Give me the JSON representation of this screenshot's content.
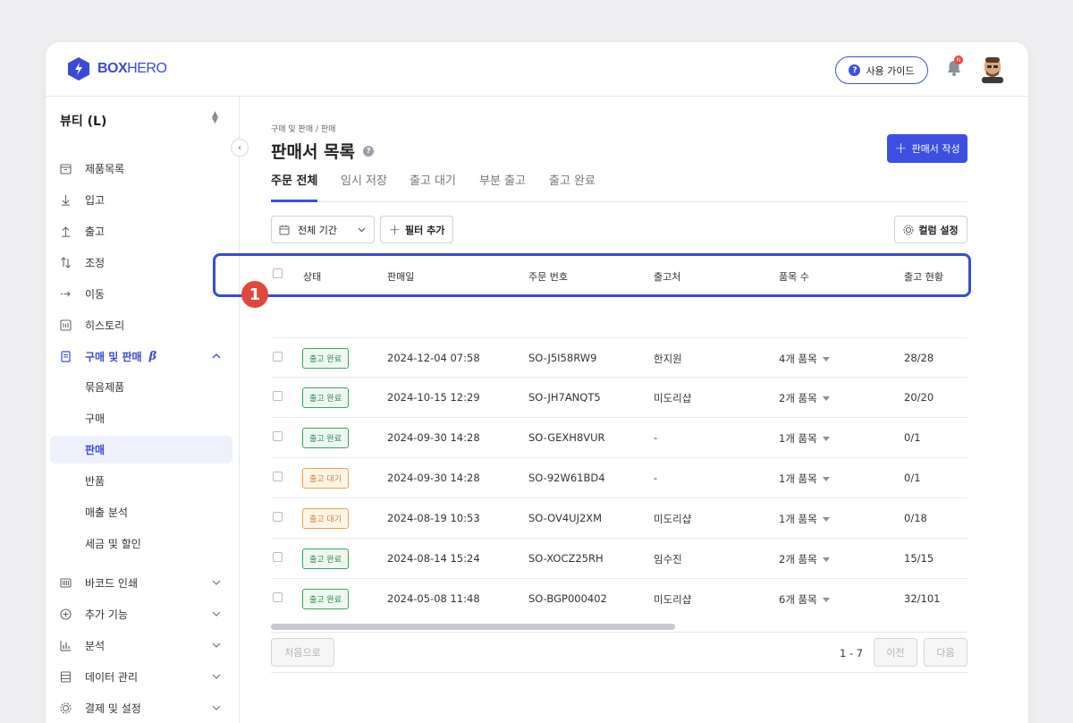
{
  "brand": {
    "name_bold": "BOX",
    "name_light": "HERO",
    "color": "#3a4ad6"
  },
  "header": {
    "guide_label": "사용 가이드",
    "notification_badge": "N"
  },
  "sidebar": {
    "company": "뷰티 (L)",
    "items": [
      {
        "label": "제품목록",
        "icon": "box-icon"
      },
      {
        "label": "입고",
        "icon": "arrow-down-icon"
      },
      {
        "label": "출고",
        "icon": "arrow-up-icon"
      },
      {
        "label": "조정",
        "icon": "swap-icon"
      },
      {
        "label": "이동",
        "icon": "arrow-right-icon"
      },
      {
        "label": "히스토리",
        "icon": "history-icon"
      },
      {
        "label": "구매 및 판매",
        "icon": "document-icon",
        "beta": "β"
      }
    ],
    "sub_items": [
      "묶음제품",
      "구매",
      "판매",
      "반품",
      "매출 분석",
      "세금 및 할인"
    ],
    "bottom_items": [
      {
        "label": "바코드 인쇄",
        "icon": "barcode-icon"
      },
      {
        "label": "추가 기능",
        "icon": "plus-circle-icon"
      },
      {
        "label": "분석",
        "icon": "bar-chart-icon"
      },
      {
        "label": "데이터 관리",
        "icon": "database-icon"
      },
      {
        "label": "결제 및 설정",
        "icon": "gear-icon"
      }
    ]
  },
  "main": {
    "breadcrumb": "구매 및 판매 / 판매",
    "title": "판매서 목록",
    "create_label": "판매서 작성",
    "tabs": [
      "주문 전체",
      "임시 저장",
      "출고 대기",
      "부분 출고",
      "출고 완료"
    ],
    "filters": {
      "period": "전체 기간",
      "add_filter": "필터 추가",
      "column_settings": "컬럼 설정"
    },
    "columns": [
      "상태",
      "판매일",
      "주문 번호",
      "출고처",
      "품목 수",
      "출고 현황"
    ],
    "rows": [
      {
        "status": "출고 완료",
        "date": "2024-12-04 07:58",
        "order": "SO-J5I58RW9",
        "dest": "한지원",
        "items": "4개 품목",
        "progress": "28/28"
      },
      {
        "status": "출고 완료",
        "date": "2024-10-15 12:29",
        "order": "SO-JH7ANQT5",
        "dest": "미도리샵",
        "items": "2개 품목",
        "progress": "20/20"
      },
      {
        "status": "출고 완료",
        "date": "2024-09-30 14:28",
        "order": "SO-GEXH8VUR",
        "dest": "-",
        "items": "1개 품목",
        "progress": "0/1"
      },
      {
        "status": "출고 대기",
        "date": "2024-09-30 14:28",
        "order": "SO-92W61BD4",
        "dest": "-",
        "items": "1개 품목",
        "progress": "0/1"
      },
      {
        "status": "출고 대기",
        "date": "2024-08-19 10:53",
        "order": "SO-OV4UJ2XM",
        "dest": "미도리샵",
        "items": "1개 품목",
        "progress": "0/18"
      },
      {
        "status": "출고 완료",
        "date": "2024-08-14 15:24",
        "order": "SO-XOCZ25RH",
        "dest": "임수진",
        "items": "2개 품목",
        "progress": "15/15"
      },
      {
        "status": "출고 완료",
        "date": "2024-05-08 11:48",
        "order": "SO-BGP000402",
        "dest": "미도리샵",
        "items": "6개 품목",
        "progress": "32/101"
      }
    ],
    "pagination": {
      "first": "처음으로",
      "range": "1 - 7",
      "prev": "이전",
      "next": "다음"
    },
    "step_marker": "1"
  },
  "colors": {
    "accent": "#3c4fe0",
    "done": "#2f8b4c",
    "waiting": "#d9822b",
    "marker": "#e1483c"
  }
}
